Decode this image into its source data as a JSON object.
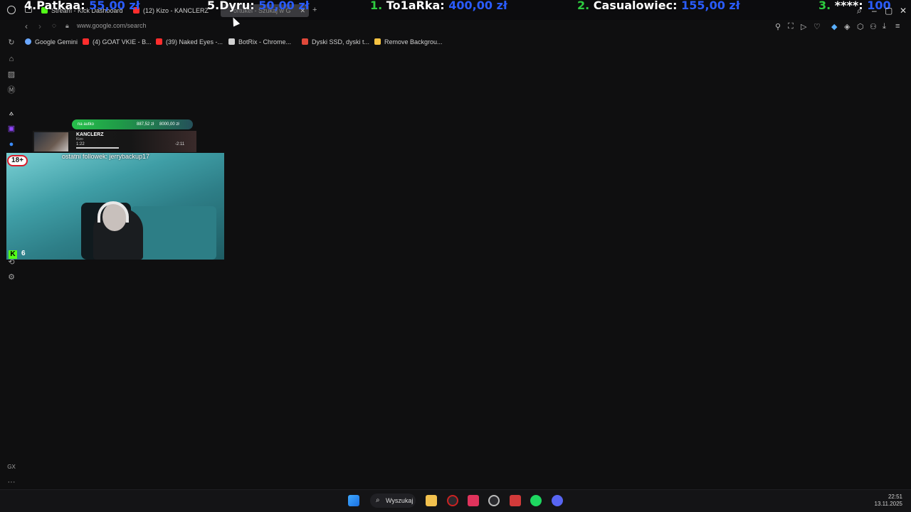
{
  "ticker": [
    {
      "rank": "4.",
      "name": "Patkaa:",
      "amount": "55,00 zł"
    },
    {
      "rank": "5.",
      "name": "Dyru:",
      "amount": "50,00 zł"
    },
    {
      "rank": "1.",
      "name": "To1aRka:",
      "amount": "400,00 zł"
    },
    {
      "rank": "2.",
      "name": "Casualowiec:",
      "amount": "155,00 zł"
    },
    {
      "rank": "3.",
      "name": "****:",
      "amount": "100"
    }
  ],
  "tabs": [
    {
      "label": "Stream - Kick Dashboard",
      "color": "#53fc18"
    },
    {
      "label": "(12) Kizo - KANCLERZ",
      "color": "#ff2d2d"
    },
    {
      "label": "ortukel - Szukaj w G",
      "color": "#888888",
      "active": true
    }
  ],
  "address": {
    "url": "www.google.com/search"
  },
  "bookmarks": [
    {
      "label": "Google Gemini",
      "color": "#6aa7ff"
    },
    {
      "label": "(4) GOAT VKIE - B...",
      "color": "#ff2d2d"
    },
    {
      "label": "(39) Naked Eyes -...",
      "color": "#ff2d2d"
    },
    {
      "label": "BotRix - Chrome...",
      "color": "#d0d0d0"
    },
    {
      "label": "Dyski SSD, dyski t...",
      "color": "#e0483a"
    },
    {
      "label": "Remove Backgrou...",
      "color": "#f5c242"
    }
  ],
  "sidebar": {
    "gx_label": "GX",
    "more_label": "···"
  },
  "overlay": {
    "donation_label": "na autko",
    "donation_progress": "887,52 zł",
    "donation_goal": "8000,00 zł",
    "track_title": "KANCLERZ",
    "track_artist": "Kizo",
    "time_elapsed": "1:22",
    "time_remaining": "-2:11",
    "last_follower": "ostatni followek: jerrybackup17",
    "age_badge": "18+",
    "viewer_count": "6"
  },
  "taskbar": {
    "search_label": "Wyszukaj",
    "time": "22:51",
    "date": "13.11.2025"
  }
}
